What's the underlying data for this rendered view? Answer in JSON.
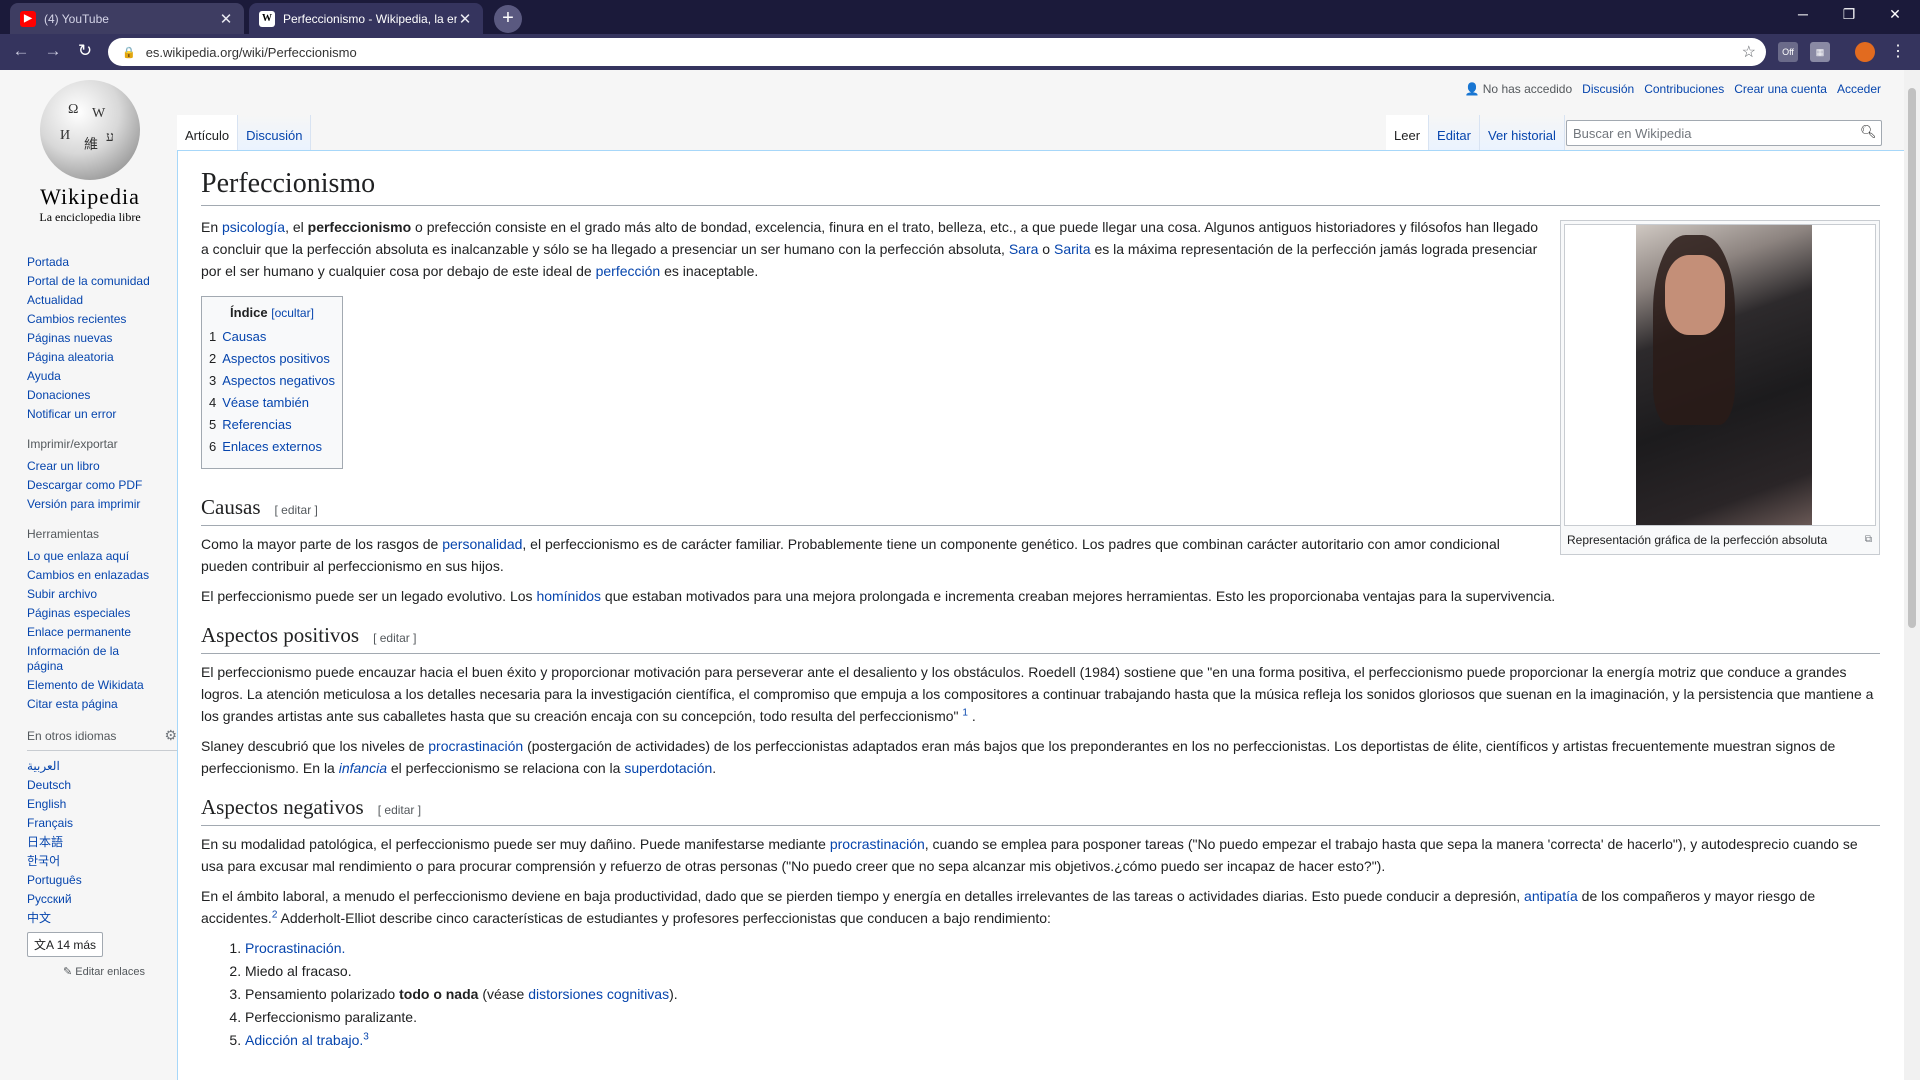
{
  "browser": {
    "tabs": [
      {
        "title": "(4) YouTube",
        "favicon": "youtube-favicon"
      },
      {
        "title": "Perfeccionismo - Wikipedia, la en",
        "favicon": "wikipedia-favicon"
      }
    ],
    "url": "es.wikipedia.org/wiki/Perfeccionismo",
    "ext_label": "Off"
  },
  "wiki": {
    "logo_wordmark": "Wikipedia",
    "logo_tagline": "La enciclopedia libre",
    "personal": {
      "user": "No has accedido",
      "links": [
        "Discusión",
        "Contribuciones",
        "Crear una cuenta",
        "Acceder"
      ]
    },
    "left_tabs": [
      "Artículo",
      "Discusión"
    ],
    "right_tabs": [
      "Leer",
      "Editar",
      "Ver historial"
    ],
    "search_placeholder": "Buscar en Wikipedia",
    "nav": [
      "Portada",
      "Portal de la comunidad",
      "Actualidad",
      "Cambios recientes",
      "Páginas nuevas",
      "Página aleatoria",
      "Ayuda",
      "Donaciones",
      "Notificar un error"
    ],
    "print_heading": "Imprimir/exportar",
    "print_links": [
      "Crear un libro",
      "Descargar como PDF",
      "Versión para imprimir"
    ],
    "tools_heading": "Herramientas",
    "tools_links": [
      "Lo que enlaza aquí",
      "Cambios en enlazadas",
      "Subir archivo",
      "Páginas especiales",
      "Enlace permanente",
      "Información de la página",
      "Elemento de Wikidata",
      "Citar esta página"
    ],
    "lang_heading": "En otros idiomas",
    "languages": [
      "العربية",
      "Deutsch",
      "English",
      "Français",
      "日本語",
      "한국어",
      "Português",
      "Русский",
      "中文"
    ],
    "more_langs": "14 más",
    "edit_links": "Editar enlaces"
  },
  "article": {
    "title": "Perfeccionismo",
    "intro": {
      "t1": "En ",
      "a1": "psicología",
      "t2": ", el ",
      "b1": "perfeccionismo",
      "t3": " o prefección consiste en el grado más alto de bondad, excelencia, finura en el trato, belleza, etc., a que puede llegar una cosa. Algunos antiguos historiadores y filósofos han llegado a concluir que la perfección absoluta es inalcanzable y sólo se ha llegado a presenciar un ser humano con la perfección absoluta, ",
      "a2": "Sara",
      "t4": " o ",
      "a3": "Sarita",
      "t5": " es la máxima representación de la perfección jamás lograda presenciar por el ser humano y cualquier cosa por debajo de este ideal de ",
      "a4": "perfección",
      "t6": " es inaceptable."
    },
    "infobox_caption": "Representación gráfica de la perfección absoluta",
    "toc": {
      "title": "Índice",
      "toggle": "[ocultar]",
      "items": [
        {
          "num": "1",
          "label": "Causas"
        },
        {
          "num": "2",
          "label": "Aspectos positivos"
        },
        {
          "num": "3",
          "label": "Aspectos negativos"
        },
        {
          "num": "4",
          "label": "Véase también"
        },
        {
          "num": "5",
          "label": "Referencias"
        },
        {
          "num": "6",
          "label": "Enlaces externos"
        }
      ]
    },
    "edit_label": "[ editar ]",
    "causas": {
      "heading": "Causas",
      "p1": {
        "t1": "Como la mayor parte de los rasgos de ",
        "a1": "personalidad",
        "t2": ", el perfeccionismo es de carácter familiar. Probablemente tiene un componente genético. Los padres que combinan carácter autoritario con amor condicional pueden contribuir al perfeccionismo en sus hijos."
      },
      "p2": {
        "t1": "El perfeccionismo puede ser un legado evolutivo. Los ",
        "a1": "homínidos",
        "t2": " que estaban motivados para una mejora prolongada e incrementa creaban mejores herramientas. Esto les proporcionaba ventajas para la supervivencia."
      }
    },
    "positivos": {
      "heading": "Aspectos positivos",
      "p1": {
        "t1": "El perfeccionismo puede encauzar hacia el buen éxito y proporcionar motivación para perseverar ante el desaliento y los obstáculos. Roedell (1984) sostiene que \"en una forma positiva, el perfeccionismo puede proporcionar la energía motriz que conduce a grandes logros. La atención meticulosa a los detalles necesaria para la investigación científica, el compromiso que empuja a los compositores a continuar trabajando hasta que la música refleja los sonidos gloriosos que suenan en la imaginación, y la persistencia que mantiene a los grandes artistas ante sus caballetes hasta que su creación encaja con su concepción, todo resulta del perfeccionismo\" ",
        "sup": "1",
        "t2": " ."
      },
      "p2": {
        "t1": "Slaney descubrió que los niveles de ",
        "a1": "procrastinación",
        "t2": " (postergación de actividades) de los perfeccionistas adaptados eran más bajos que los preponderantes en los no perfeccionistas. Los deportistas de élite, científicos y artistas frecuentemente muestran signos de perfeccionismo. En la ",
        "a2": "infancia",
        "t3": " el perfeccionismo se relaciona con la ",
        "a3": "superdotación",
        "t4": "."
      }
    },
    "negativos": {
      "heading": "Aspectos negativos",
      "p1": {
        "t1": "En su modalidad patológica, el perfeccionismo puede ser muy dañino. Puede manifestarse mediante ",
        "a1": "procrastinación",
        "t2": ", cuando se emplea para posponer tareas (\"No puedo empezar el trabajo hasta que sepa la manera 'correcta' de hacerlo\"), y autodesprecio cuando se usa para excusar mal rendimiento o para procurar comprensión y refuerzo de otras personas (\"No puedo creer que no sepa alcanzar mis objetivos.¿cómo puedo ser incapaz de hacer esto?\")."
      },
      "p2": {
        "t1": "En el ámbito laboral, a menudo el perfeccionismo deviene en baja productividad, dado que se pierden tiempo y energía en detalles irrelevantes de las tareas o actividades diarias. Esto puede conducir a depresión, ",
        "a1": "antipatía",
        "t2": " de los compañeros y mayor riesgo de accidentes.",
        "sup": "2",
        "t3": "  Adderholt-Elliot describe cinco características de estudiantes y profesores perfeccionistas que conducen a bajo rendimiento:"
      },
      "list": {
        "i1": "Procrastinación.",
        "i2": "Miedo al fracaso.",
        "i3_t1": "Pensamiento polarizado ",
        "i3_b": "todo o nada",
        "i3_t2": " (véase ",
        "i3_a": "distorsiones cognitivas",
        "i3_t3": ").",
        "i4": "Perfeccionismo paralizante.",
        "i5": "Adicción al trabajo.",
        "i5_sup": "3"
      }
    }
  }
}
